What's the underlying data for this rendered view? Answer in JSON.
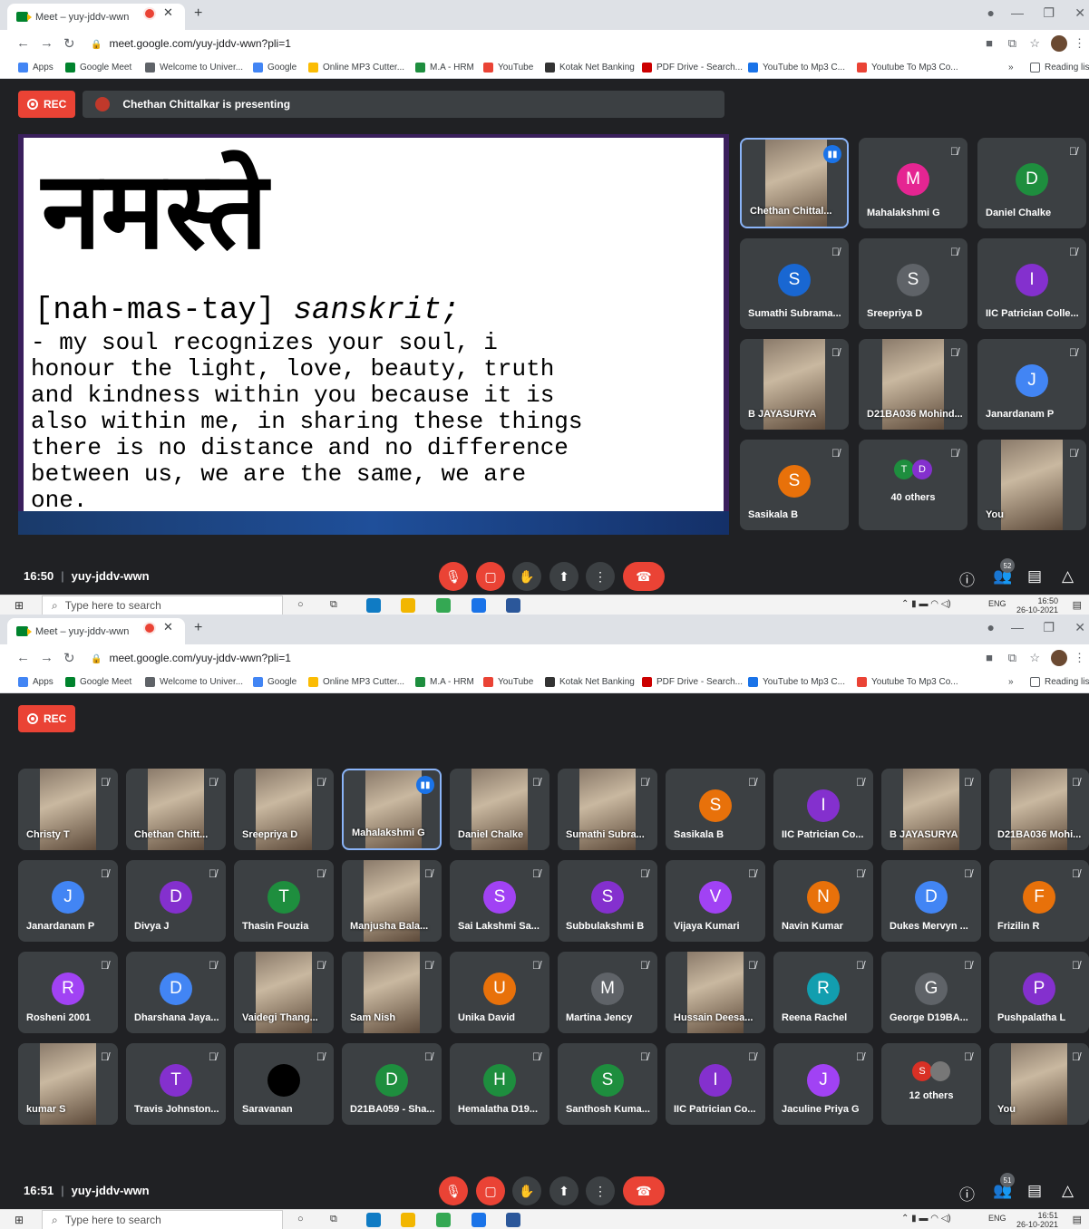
{
  "browser": {
    "tab_title": "Meet – yuy-jddv-wwn",
    "url": "meet.google.com/yuy-jddv-wwn?pli=1",
    "bookmarks": [
      "Apps",
      "Google Meet",
      "Welcome to Univer...",
      "Google",
      "Online MP3 Cutter...",
      "M.A - HRM",
      "YouTube",
      "Kotak Net Banking",
      "PDF Drive - Search...",
      "YouTube to Mp3 C...",
      "Youtube To Mp3 Co..."
    ],
    "reading_list": "Reading list"
  },
  "shot1": {
    "rec_label": "REC",
    "presenting": "Chethan Chittalkar is presenting",
    "slide": {
      "devanagari": "नमस्ते",
      "pron": "[nah-mas-tay]",
      "lang": "sanskrit;",
      "lines": [
        "- my soul recognizes your soul, i",
        "honour the light, love, beauty, truth",
        "and kindness within you because it is",
        "also within me, in sharing these things",
        "there is no distance and no difference",
        "between us, we are the same, we are",
        "one."
      ]
    },
    "tiles": [
      {
        "name": "Chethan Chittal...",
        "type": "photo"
      },
      {
        "name": "Mahalakshmi G",
        "initial": "M",
        "color": "#e52592"
      },
      {
        "name": "Daniel Chalke",
        "initial": "D",
        "color": "#1e8e3e"
      },
      {
        "name": "Sumathi Subrama...",
        "initial": "S",
        "color": "#1967d2"
      },
      {
        "name": "Sreepriya D",
        "initial": "S",
        "color": "#5f6368"
      },
      {
        "name": "IIC Patrician Colle...",
        "initial": "I",
        "color": "#8430ce"
      },
      {
        "name": "B JAYASURYA",
        "type": "photo"
      },
      {
        "name": "D21BA036 Mohind...",
        "type": "photo"
      },
      {
        "name": "Janardanam P",
        "initial": "J",
        "color": "#4285f4"
      },
      {
        "name": "Sasikala B",
        "initial": "S",
        "color": "#e8710a"
      },
      {
        "name": "40 others",
        "type": "others",
        "a": "T",
        "b": "D",
        "ca": "#1e8e3e",
        "cb": "#8430ce"
      },
      {
        "name": "You",
        "type": "photo"
      }
    ],
    "time": "16:50",
    "meeting_code": "yuy-jddv-wwn",
    "people_count": "52",
    "taskbar_time": "16:50",
    "taskbar_date": "26-10-2021"
  },
  "shot2": {
    "rec_label": "REC",
    "tiles": [
      {
        "name": "Christy T",
        "type": "photo"
      },
      {
        "name": "Chethan Chitt...",
        "type": "photo"
      },
      {
        "name": "Sreepriya D",
        "type": "photo"
      },
      {
        "name": "Mahalakshmi G",
        "type": "photo"
      },
      {
        "name": "Daniel Chalke",
        "type": "photo"
      },
      {
        "name": "Sumathi Subra...",
        "type": "photo"
      },
      {
        "name": "Sasikala B",
        "initial": "S",
        "color": "#e8710a"
      },
      {
        "name": "IIC Patrician Co...",
        "initial": "I",
        "color": "#8430ce"
      },
      {
        "name": "B JAYASURYA",
        "type": "photo"
      },
      {
        "name": "D21BA036 Mohi...",
        "type": "photo"
      },
      {
        "name": "Janardanam P",
        "initial": "J",
        "color": "#4285f4"
      },
      {
        "name": "Divya J",
        "initial": "D",
        "color": "#8430ce"
      },
      {
        "name": "Thasin Fouzia",
        "initial": "T",
        "color": "#1e8e3e"
      },
      {
        "name": "Manjusha Bala...",
        "type": "photo"
      },
      {
        "name": "Sai Lakshmi Sa...",
        "initial": "S",
        "color": "#a142f4"
      },
      {
        "name": "Subbulakshmi B",
        "initial": "S",
        "color": "#8430ce"
      },
      {
        "name": "Vijaya Kumari",
        "initial": "V",
        "color": "#a142f4"
      },
      {
        "name": "Navin Kumar",
        "initial": "N",
        "color": "#e8710a"
      },
      {
        "name": "Dukes Mervyn ...",
        "initial": "D",
        "color": "#4285f4"
      },
      {
        "name": "Frizilin R",
        "initial": "F",
        "color": "#e8710a"
      },
      {
        "name": "Rosheni 2001",
        "initial": "R",
        "color": "#a142f4"
      },
      {
        "name": "Dharshana Jaya...",
        "initial": "D",
        "color": "#4285f4"
      },
      {
        "name": "Vaidegi Thang...",
        "type": "photo"
      },
      {
        "name": "Sam Nish",
        "type": "photo"
      },
      {
        "name": "Unika David",
        "initial": "U",
        "color": "#e8710a"
      },
      {
        "name": "Martina Jency",
        "initial": "M",
        "color": "#5f6368"
      },
      {
        "name": "Hussain Deesa...",
        "type": "photo"
      },
      {
        "name": "Reena Rachel",
        "initial": "R",
        "color": "#129eaf"
      },
      {
        "name": "George D19BA...",
        "initial": "G",
        "color": "#5f6368"
      },
      {
        "name": "Pushpalatha L",
        "initial": "P",
        "color": "#8430ce"
      },
      {
        "name": "kumar S",
        "type": "photo"
      },
      {
        "name": "Travis Johnston...",
        "initial": "T",
        "color": "#8430ce"
      },
      {
        "name": "Saravanan",
        "initial": "",
        "color": "#000000"
      },
      {
        "name": "D21BA059 - Sha...",
        "initial": "D",
        "color": "#1e8e3e"
      },
      {
        "name": "Hemalatha D19...",
        "initial": "H",
        "color": "#1e8e3e"
      },
      {
        "name": "Santhosh Kuma...",
        "initial": "S",
        "color": "#1e8e3e"
      },
      {
        "name": "IIC Patrician Co...",
        "initial": "I",
        "color": "#8430ce"
      },
      {
        "name": "Jaculine Priya G",
        "initial": "J",
        "color": "#a142f4"
      },
      {
        "name": "12 others",
        "type": "others",
        "a": "S",
        "b": "",
        "ca": "#d93025",
        "cb": "#777777"
      },
      {
        "name": "You",
        "type": "photo"
      }
    ],
    "time": "16:51",
    "meeting_code": "yuy-jddv-wwn",
    "people_count": "51",
    "taskbar_time": "16:51",
    "taskbar_date": "26-10-2021"
  },
  "taskbar": {
    "search_placeholder": "Type here to search",
    "lang": "ENG"
  }
}
